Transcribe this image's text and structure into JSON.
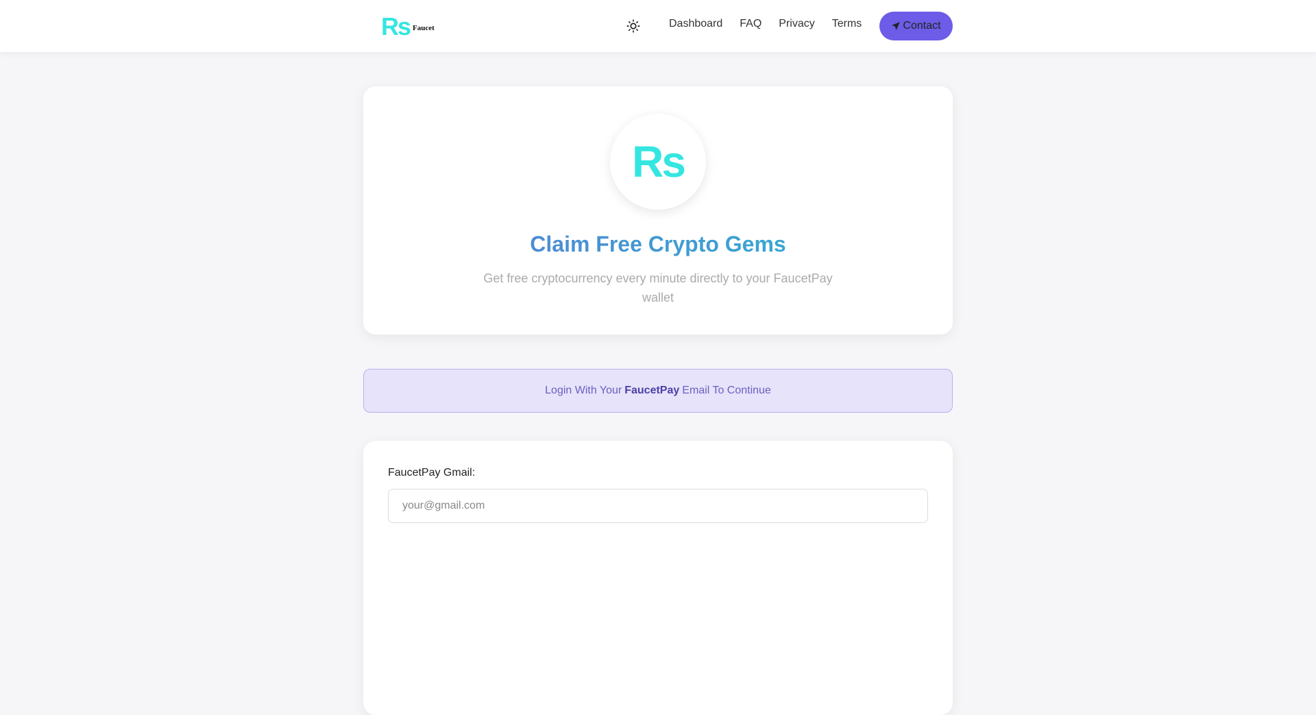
{
  "brand": {
    "mark": "Rs",
    "name": "Faucet"
  },
  "nav": {
    "theme_icon": "sun-icon",
    "links": [
      "Dashboard",
      "FAQ",
      "Privacy",
      "Terms"
    ],
    "contact_label": "Contact",
    "contact_icon": "paper-plane-icon"
  },
  "hero": {
    "logo_mark": "Rs",
    "title": "Claim Free Crypto Gems",
    "subtitle": "Get free cryptocurrency every minute directly to your FaucetPay wallet"
  },
  "notice": {
    "prefix": "Login With Your",
    "highlight": "FaucetPay",
    "suffix": "Email To Continue"
  },
  "form": {
    "email_label": "FaucetPay Gmail:",
    "email_placeholder": "your@gmail.com",
    "email_value": ""
  },
  "colors": {
    "accent": "#6c5ce7",
    "brand_cyan": "#35e6e0",
    "title_gradient_start": "#5a7bd6",
    "title_gradient_end": "#2bb7d0",
    "notice_bg": "#e6e3fa"
  }
}
